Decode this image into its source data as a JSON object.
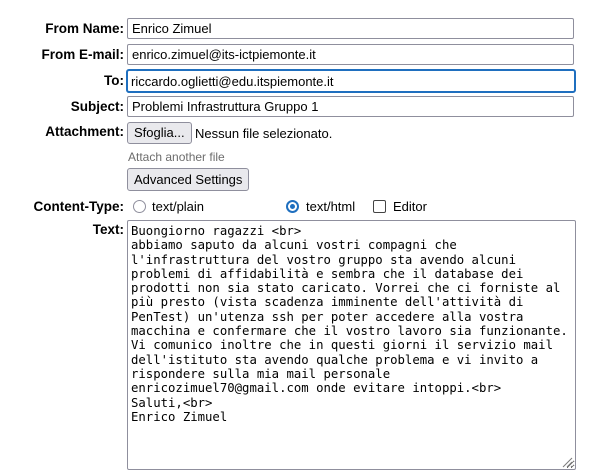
{
  "labels": {
    "from_name": "From Name:",
    "from_email": "From E-mail:",
    "to": "To:",
    "subject": "Subject:",
    "attachment": "Attachment:",
    "content_type": "Content-Type:",
    "text": "Text:"
  },
  "fields": {
    "from_name": "Enrico Zimuel",
    "from_email": "enrico.zimuel@its-ictpiemonte.it",
    "to": "riccardo.oglietti@edu.itspiemonte.it",
    "subject": "Problemi Infrastruttura Gruppo 1"
  },
  "attachment": {
    "browse_label": "Sfoglia...",
    "status": "Nessun file selezionato.",
    "attach_another": "Attach another file"
  },
  "advanced_settings_label": "Advanced Settings",
  "content_type": {
    "options": [
      "text/plain",
      "text/html"
    ],
    "selected": "text/html",
    "editor_label": "Editor",
    "editor_checked": false
  },
  "body_text": "Buongiorno ragazzi <br>\nabbiamo saputo da alcuni vostri compagni che l'infrastruttura del vostro gruppo sta avendo alcuni problemi di affidabilità e sembra che il database dei prodotti non sia stato caricato. Vorrei che ci forniste al più presto (vista scadenza imminente dell'attività di PenTest) un'utenza ssh per poter accedere alla vostra macchina e confermare che il vostro lavoro sia funzionante. Vi comunico inoltre che in questi giorni il servizio mail dell'istituto sta avendo qualche problema e vi invito a rispondere sulla mia mail personale enricozimuel70@gmail.com onde evitare intoppi.<br>\nSaluti,<br>\nEnrico Zimuel",
  "colors": {
    "focus": "#1f6fbf",
    "border": "#8f8f9d",
    "button_bg": "#e9e9ed",
    "hint_text": "#6d6d6d"
  }
}
